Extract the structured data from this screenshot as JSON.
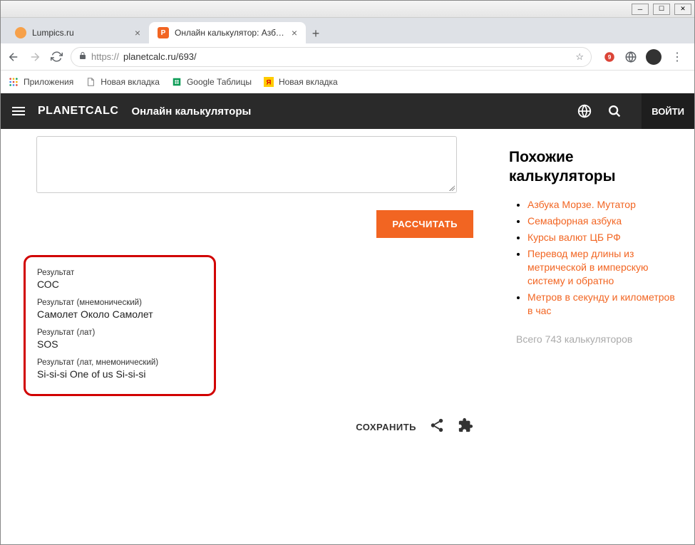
{
  "tabs": [
    {
      "title": "Lumpics.ru"
    },
    {
      "title": "Онлайн калькулятор: Азбука М…"
    }
  ],
  "url": "planetcalc.ru/693/",
  "url_scheme": "https://",
  "bookmarks": {
    "apps": "Приложения",
    "newtab1": "Новая вкладка",
    "gtables": "Google Таблицы",
    "newtab2": "Новая вкладка"
  },
  "header": {
    "logo": "PLANETCALC",
    "subtitle": "Онлайн калькуляторы",
    "login": "ВОЙТИ"
  },
  "calc_button": "РАССЧИТАТЬ",
  "results": {
    "r1_label": "Результат",
    "r1_value": "СОС",
    "r2_label": "Результат (мнемонический)",
    "r2_value": "Самолет Около Самолет",
    "r3_label": "Результат (лат)",
    "r3_value": "SOS",
    "r4_label": "Результат (лат, мнемонический)",
    "r4_value": "Si-si-si One of us Si-si-si"
  },
  "save_button": "СОХРАНИТЬ",
  "sidebar": {
    "title": "Похожие калькуляторы",
    "items": [
      "Азбука Морзе. Мутатор",
      "Семафорная азбука",
      "Курсы валют ЦБ РФ",
      "Перевод мер длины из метрической в имперскую систему и обратно",
      "Метров в секунду и километров в час"
    ],
    "total": "Всего 743 калькуляторов"
  }
}
